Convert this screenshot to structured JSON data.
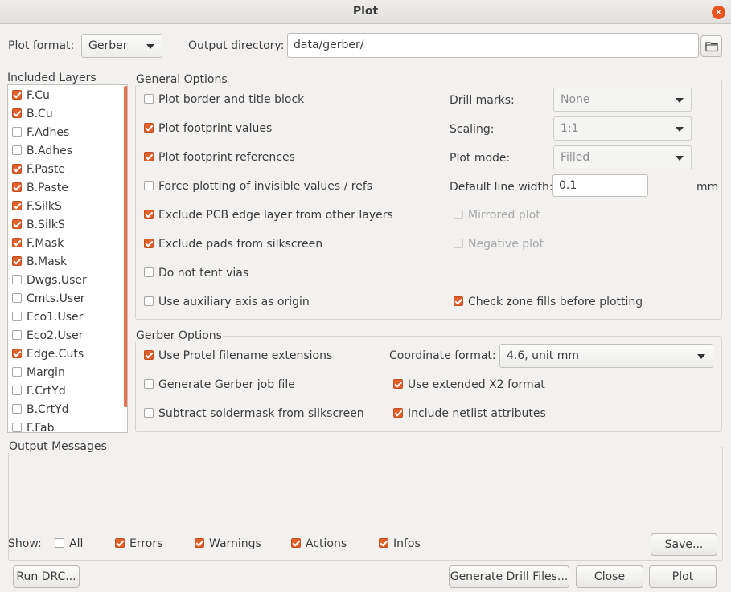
{
  "window": {
    "title": "Plot",
    "close_symbol": "✕"
  },
  "top": {
    "plot_format_label": "Plot format:",
    "plot_format_value": "Gerber",
    "output_dir_label": "Output directory:",
    "output_dir_value": "data/gerber/"
  },
  "layers": {
    "title": "Included Layers",
    "items": [
      {
        "label": "F.Cu",
        "checked": true
      },
      {
        "label": "B.Cu",
        "checked": true
      },
      {
        "label": "F.Adhes",
        "checked": false
      },
      {
        "label": "B.Adhes",
        "checked": false
      },
      {
        "label": "F.Paste",
        "checked": true
      },
      {
        "label": "B.Paste",
        "checked": true
      },
      {
        "label": "F.SilkS",
        "checked": true
      },
      {
        "label": "B.SilkS",
        "checked": true
      },
      {
        "label": "F.Mask",
        "checked": true
      },
      {
        "label": "B.Mask",
        "checked": true
      },
      {
        "label": "Dwgs.User",
        "checked": false
      },
      {
        "label": "Cmts.User",
        "checked": false
      },
      {
        "label": "Eco1.User",
        "checked": false
      },
      {
        "label": "Eco2.User",
        "checked": false
      },
      {
        "label": "Edge.Cuts",
        "checked": true
      },
      {
        "label": "Margin",
        "checked": false
      },
      {
        "label": "F.CrtYd",
        "checked": false
      },
      {
        "label": "B.CrtYd",
        "checked": false
      },
      {
        "label": "F.Fab",
        "checked": false
      }
    ]
  },
  "general": {
    "title": "General Options",
    "options": [
      {
        "label": "Plot border and title block",
        "checked": false
      },
      {
        "label": "Plot footprint values",
        "checked": true
      },
      {
        "label": "Plot footprint references",
        "checked": true
      },
      {
        "label": "Force plotting of invisible values / refs",
        "checked": false
      },
      {
        "label": "Exclude PCB edge layer from other layers",
        "checked": true
      },
      {
        "label": "Exclude pads from silkscreen",
        "checked": true
      },
      {
        "label": "Do not tent vias",
        "checked": false
      },
      {
        "label": "Use auxiliary axis as origin",
        "checked": false
      }
    ],
    "drill_marks_label": "Drill marks:",
    "drill_marks_value": "None",
    "scaling_label": "Scaling:",
    "scaling_value": "1:1",
    "plot_mode_label": "Plot mode:",
    "plot_mode_value": "Filled",
    "line_width_label": "Default line width:",
    "line_width_value": "0.1",
    "line_width_unit": "mm",
    "mirrored_label": "Mirrored plot",
    "negative_label": "Negative plot",
    "check_zone_label": "Check zone fills before plotting"
  },
  "gerber": {
    "title": "Gerber Options",
    "protel_label": "Use Protel filename extensions",
    "job_file_label": "Generate Gerber job file",
    "subtract_label": "Subtract soldermask from silkscreen",
    "coord_label": "Coordinate format:",
    "coord_value": "4.6, unit mm",
    "x2_label": "Use extended X2 format",
    "netlist_label": "Include netlist attributes"
  },
  "output": {
    "title": "Output Messages",
    "show_label": "Show:",
    "all_label": "All",
    "errors_label": "Errors",
    "warnings_label": "Warnings",
    "actions_label": "Actions",
    "infos_label": "Infos",
    "save_label": "Save..."
  },
  "buttons": {
    "run_drc": "Run DRC...",
    "generate_drill": "Generate Drill Files...",
    "close": "Close",
    "plot": "Plot"
  },
  "colors": {
    "accent": "#e05f2a",
    "close_button": "#e9541f"
  }
}
